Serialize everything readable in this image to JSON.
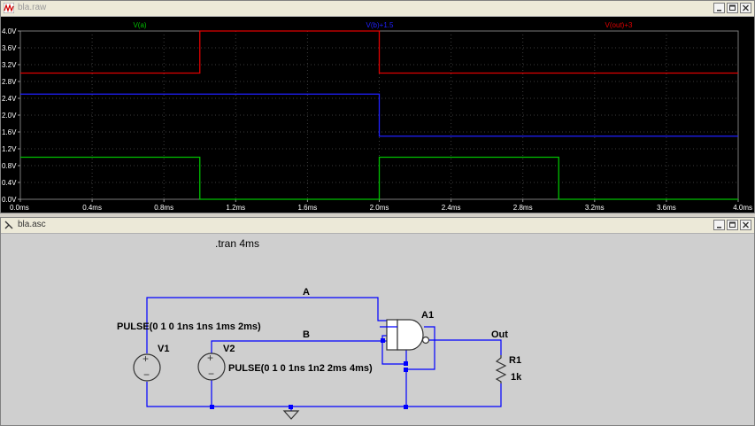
{
  "wave_window": {
    "title": "bla.raw"
  },
  "schematic_window": {
    "title": "bla.asc"
  },
  "colors": {
    "va": "#00c000",
    "vb": "#2020ff",
    "vout": "#e00000",
    "plot_bg": "#000000",
    "grid": "#3c3c3c",
    "axis_label": "#ffffff",
    "wire": "#0000ff",
    "schem_text": "#000000"
  },
  "chart_data": {
    "type": "line",
    "xlim": [
      0,
      4.0
    ],
    "ylim": [
      0,
      4.0
    ],
    "x_unit": "ms",
    "y_unit": "V",
    "grid": true,
    "x_ticks": [
      "0.0ms",
      "0.4ms",
      "0.8ms",
      "1.2ms",
      "1.6ms",
      "2.0ms",
      "2.4ms",
      "2.8ms",
      "3.2ms",
      "3.6ms",
      "4.0ms"
    ],
    "y_ticks": [
      "0.0V",
      "0.4V",
      "0.8V",
      "1.2V",
      "1.6V",
      "2.0V",
      "2.4V",
      "2.8V",
      "3.2V",
      "3.6V",
      "4.0V"
    ],
    "series": [
      {
        "name": "V(a)",
        "color": "#00c000",
        "x": [
          0,
          1.0,
          1.0,
          2.0,
          2.0,
          3.0,
          3.0,
          4.0
        ],
        "y": [
          1,
          1,
          0,
          0,
          1,
          1,
          0,
          0
        ]
      },
      {
        "name": "V(b)+1.5",
        "color": "#2020ff",
        "x": [
          0,
          2.0,
          2.0,
          4.0
        ],
        "y": [
          2.5,
          2.5,
          1.5,
          1.5
        ]
      },
      {
        "name": "V(out)+3",
        "color": "#e00000",
        "x": [
          0,
          1.0,
          1.0,
          2.0,
          2.0,
          4.0
        ],
        "y": [
          3,
          3,
          4,
          4,
          3,
          3
        ]
      }
    ]
  },
  "schematic": {
    "directive": ".tran 4ms",
    "labels": {
      "net_a": "A",
      "net_b": "B",
      "net_out": "Out",
      "gate": "A1",
      "v1": "V1",
      "v2": "V2",
      "r1": "R1",
      "r1_value": "1k"
    },
    "v1_value": "PULSE(0 1 0 1ns 1ns 1ms 2ms)",
    "v2_value": "PULSE(0 1 0 1ns 1n2 2ms 4ms)"
  }
}
